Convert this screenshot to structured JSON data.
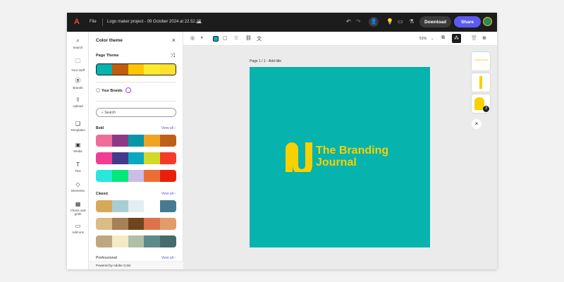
{
  "topbar": {
    "menu_file": "File",
    "project_title": "Logo maker project - 09 October 2024 at 22.52.29",
    "download": "Download",
    "share": "Share"
  },
  "rail": [
    {
      "label": "Search",
      "icon": "search-icon",
      "g": "⌕"
    },
    {
      "label": "Your stuff",
      "icon": "folder-icon",
      "g": "🗀"
    },
    {
      "label": "Brands",
      "icon": "brand-icon",
      "g": "Ⓑ"
    },
    {
      "label": "Upload",
      "icon": "upload-icon",
      "g": "⇪"
    },
    {
      "label": "Templates",
      "icon": "templates-icon",
      "g": "❏"
    },
    {
      "label": "Media",
      "icon": "media-icon",
      "g": "▣"
    },
    {
      "label": "Text",
      "icon": "text-icon",
      "g": "T"
    },
    {
      "label": "Elements",
      "icon": "elements-icon",
      "g": "◇"
    },
    {
      "label": "Charts and grids",
      "icon": "chart-icon",
      "g": "▦"
    },
    {
      "label": "Add-ons",
      "icon": "addons-icon",
      "g": "▭"
    }
  ],
  "panel": {
    "title": "Color theme",
    "page_theme": "Page Theme",
    "your_brands": "Your Brands",
    "search_placeholder": "Search",
    "bold": "Bold",
    "classic": "Classic",
    "professional": "Professional",
    "view_all": "View all ›",
    "footer": "Powered by Adobe Color",
    "page_theme_colors": [
      "#06b3ad",
      "#bf5d0c",
      "#ffc400",
      "#ffea2e",
      "#ffe02a"
    ],
    "bold_palettes": [
      [
        "#f06d99",
        "#8c3a85",
        "#0797a4",
        "#f0a424",
        "#bf6019"
      ],
      [
        "#f03e92",
        "#433a8c",
        "#0aa9bf",
        "#d3d92a",
        "#f53a2a"
      ],
      [
        "#27e8da",
        "#03e87a",
        "#cdbbe8",
        "#eb6e37",
        "#e8200a"
      ]
    ],
    "classic_palettes": [
      [
        "#d8a85a",
        "#a9cdd5",
        "#e3edf2",
        "#ffffff",
        "#467a92"
      ],
      [
        "#dbbc86",
        "#a88055",
        "#6f451c",
        "#de734b",
        "#e39a6c"
      ],
      [
        "#bfa67e",
        "#f4eac6",
        "#b0bfa7",
        "#5d8a8b",
        "#456b6b"
      ]
    ]
  },
  "toolbar": {
    "zoom": "51%"
  },
  "stage": {
    "page_label": "Page 1 / 1 - Add title",
    "logo_line1": "The Branding",
    "logo_line2": "Journal",
    "badge": "3",
    "canvas_color": "#06b3ad",
    "logo_color": "#f9d000"
  }
}
